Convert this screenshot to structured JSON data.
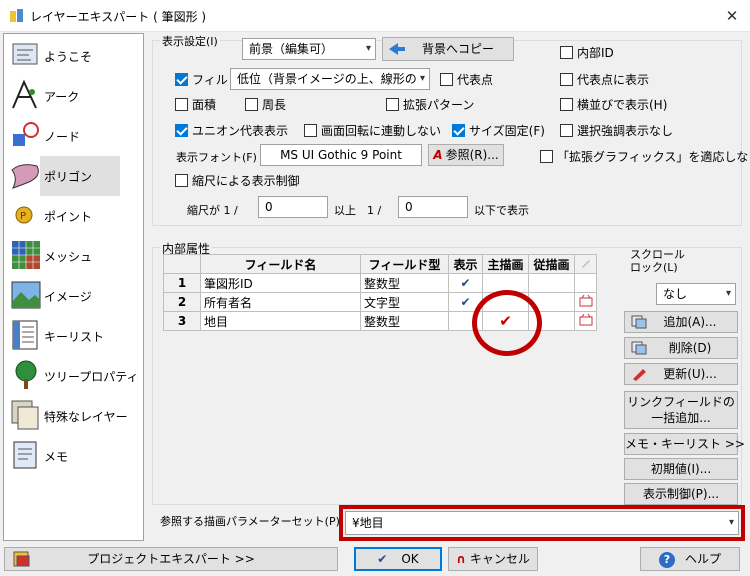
{
  "window": {
    "title": "レイヤーエキスパート ( 筆図形 )",
    "close_glyph": "✕"
  },
  "sidebar": {
    "items": [
      {
        "label": "ようこそ",
        "icon": "welcome-icon"
      },
      {
        "label": "アーク",
        "icon": "arc-icon"
      },
      {
        "label": "ノード",
        "icon": "node-icon"
      },
      {
        "label": "ポリゴン",
        "icon": "polygon-icon",
        "selected": true
      },
      {
        "label": "ポイント",
        "icon": "point-icon"
      },
      {
        "label": "メッシュ",
        "icon": "mesh-icon"
      },
      {
        "label": "イメージ",
        "icon": "image-icon"
      },
      {
        "label": "キーリスト",
        "icon": "keylist-icon"
      },
      {
        "label": "ツリープロパティ",
        "icon": "tree-property-icon"
      },
      {
        "label": "特殊なレイヤー",
        "icon": "special-layer-icon"
      },
      {
        "label": "メモ",
        "icon": "memo-icon"
      }
    ]
  },
  "display": {
    "group_title": "表示設定(I)",
    "mode_value": "前景（編集可）",
    "copy_back_label": "背景へコピー",
    "fill_label": "フィル",
    "fill_value": "低位（背景イメージの上、線形の",
    "area_label": "面積",
    "perimeter_label": "周長",
    "representative_point_label": "代表点",
    "extended_pattern_label": "拡張パターン",
    "inner_id_label": "内部ID",
    "show_at_rep_point_label": "代表点に表示",
    "show_horizontal_label": "横並びで表示(H)",
    "union_rep_label": "ユニオン代表表示",
    "screen_rotation_label": "画面回転に連動しない",
    "fixed_size_label": "サイズ固定(F)",
    "no_selection_highlight_label": "選択強調表示なし",
    "font_label": "表示フォント(F)",
    "font_value": "MS UI Gothic 9 Point",
    "browse_label": "参照(R)...",
    "ext_graphics_label": "「拡張グラフィックス」を適応しない",
    "scale_control_label": "縮尺による表示制御",
    "scale_prefix": "縮尺が 1 /",
    "scale_min": "0",
    "scale_mid": "以上　1 /",
    "scale_max": "0",
    "scale_suffix": "以下で表示"
  },
  "attributes": {
    "group_title": "内部属性",
    "columns": [
      "フィールド名",
      "フィールド型",
      "表示",
      "主描画",
      "従描画"
    ],
    "rows": [
      {
        "num": "1",
        "name": "筆図形ID",
        "type": "整数型",
        "show": true,
        "main": false,
        "sub": false,
        "link": false
      },
      {
        "num": "2",
        "name": "所有者名",
        "type": "文字型",
        "show": true,
        "main": false,
        "sub": false,
        "link": true
      },
      {
        "num": "3",
        "name": "地目",
        "type": "整数型",
        "show": false,
        "main": true,
        "sub": false,
        "link": true
      }
    ],
    "scroll_lock_label": "スクロール\nロック(L)",
    "scroll_lock_value": "なし",
    "add_label": "追加(A)...",
    "delete_label": "削除(D)",
    "update_label": "更新(U)...",
    "link_field_label": "リンクフィールドの\n一括追加...",
    "memo_keylist_label": "メモ・キーリスト >>",
    "initial_value_label": "初期値(I)...",
    "display_control_label": "表示制御(P)..."
  },
  "param_set": {
    "label": "参照する描画パラメーターセット(P)",
    "value": "¥地目"
  },
  "footer": {
    "project_expert_label": "プロジェクトエキスパート >>",
    "ok_label": "OK",
    "cancel_label": "キャンセル",
    "help_label": "ヘルプ"
  },
  "colors": {
    "accent": "#0078d7",
    "highlight": "#c00000",
    "check": "#1f4e8c"
  }
}
